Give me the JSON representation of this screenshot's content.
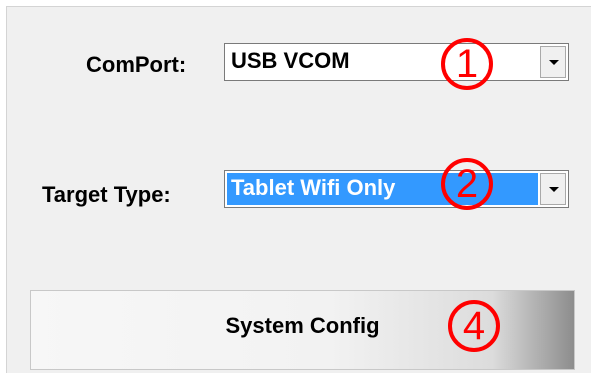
{
  "comport": {
    "label": "ComPort:",
    "value": "USB VCOM"
  },
  "target_type": {
    "label": "Target Type:",
    "value": "Tablet Wifi Only"
  },
  "system_config": {
    "label": "System Config"
  },
  "annotations": {
    "marker_1": "1",
    "marker_2": "2",
    "marker_4": "4"
  },
  "colors": {
    "selection": "#3399ff",
    "annotation": "#ff0000",
    "panel": "#f0f0f0"
  }
}
